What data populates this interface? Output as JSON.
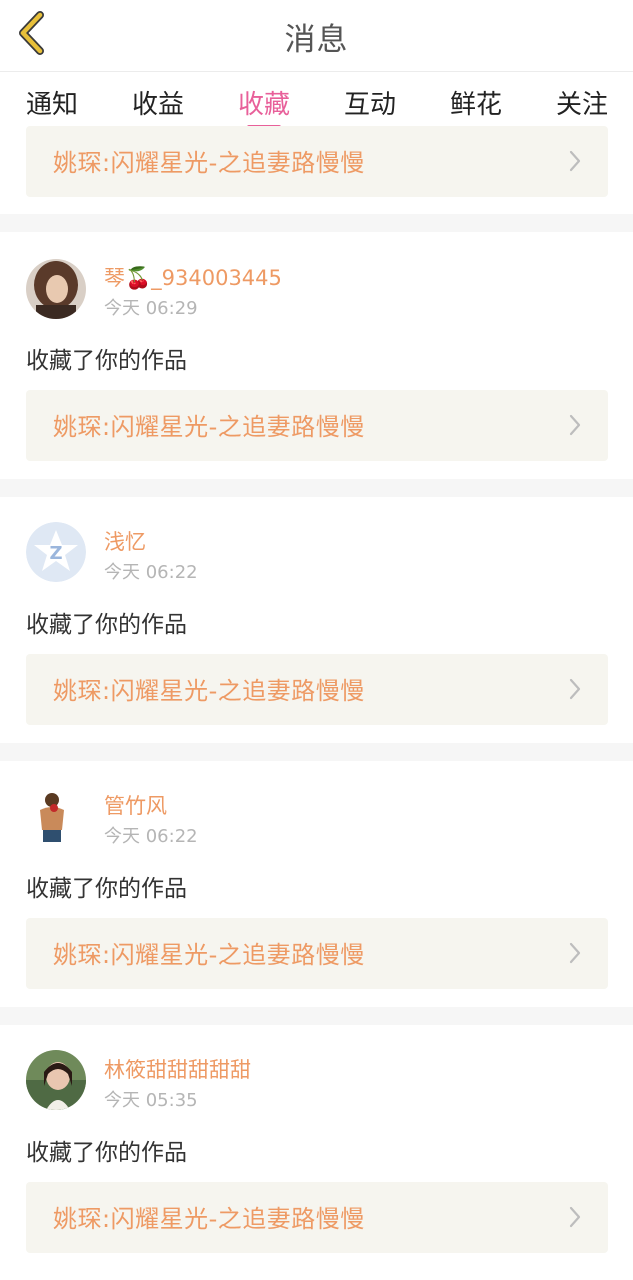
{
  "header": {
    "title": "消息",
    "back_icon": "chevron-left-icon",
    "accent": "#e8c03a"
  },
  "tabs": [
    {
      "label": "通知"
    },
    {
      "label": "收益"
    },
    {
      "label": "收藏",
      "active": true
    },
    {
      "label": "互动"
    },
    {
      "label": "鲜花"
    },
    {
      "label": "关注"
    }
  ],
  "colors": {
    "active_tab": "#e8609a",
    "username": "#ee9a64",
    "link_bg": "#f6f5ef"
  },
  "top_partial": {
    "work_title": "姚琛:闪耀星光-之追妻路慢慢"
  },
  "notifications": [
    {
      "username": "琴🍒_934003445",
      "time": "今天 06:29",
      "action": "收藏了你的作品",
      "work_title": "姚琛:闪耀星光-之追妻路慢慢"
    },
    {
      "username": "浅忆",
      "time": "今天 06:22",
      "action": "收藏了你的作品",
      "work_title": "姚琛:闪耀星光-之追妻路慢慢"
    },
    {
      "username": "管竹风",
      "time": "今天 06:22",
      "action": "收藏了你的作品",
      "work_title": "姚琛:闪耀星光-之追妻路慢慢"
    },
    {
      "username": "林筱甜甜甜甜甜",
      "time": "今天 05:35",
      "action": "收藏了你的作品",
      "work_title": "姚琛:闪耀星光-之追妻路慢慢"
    }
  ]
}
